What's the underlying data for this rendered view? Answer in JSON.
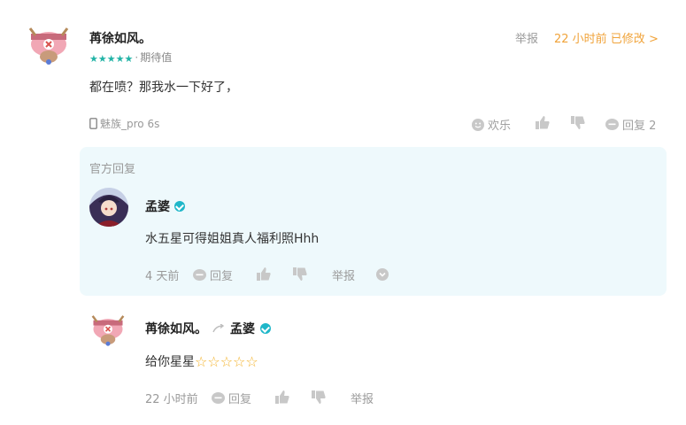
{
  "comment": {
    "username": "苒徐如风。",
    "stars": [
      "★",
      "★",
      "★",
      "★",
      "★"
    ],
    "rating_label": "期待值",
    "report_label": "举报",
    "time_label": "22 小时前 已修改 >",
    "body": "都在喷？那我水一下好了，",
    "device": "魅族_pro 6s",
    "actions": {
      "funny": "欢乐",
      "reply": "回复 2"
    }
  },
  "official_reply": {
    "section_label": "官方回复",
    "username": "孟婆",
    "body": "水五星可得姐姐真人福利照Hhh",
    "time": "4 天前",
    "reply_label": "回复",
    "report_label": "举报"
  },
  "sub_reply": {
    "username": "苒徐如风。",
    "reply_to": "孟婆",
    "body_text": "给你星星",
    "stars": [
      "☆",
      "☆",
      "☆",
      "☆",
      "☆"
    ],
    "time": "22 小时前",
    "reply_label": "回复",
    "report_label": "举报"
  },
  "colors": {
    "accent_teal": "#22b3a6",
    "orange": "#f0a33a",
    "reply_bg": "#eef9fc",
    "verified": "#1fb7c9"
  }
}
